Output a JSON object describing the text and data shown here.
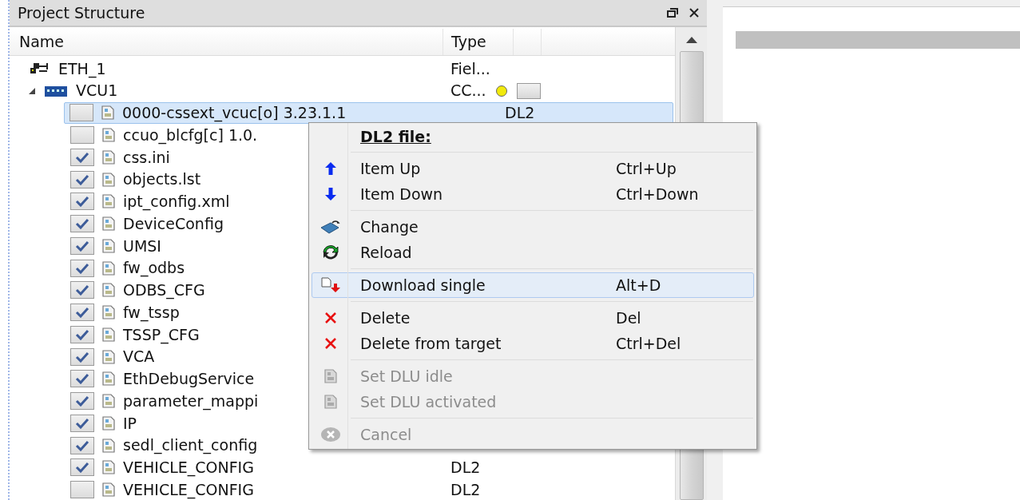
{
  "panel": {
    "title": "Project Structure"
  },
  "columns": [
    {
      "label": "Name"
    },
    {
      "label": "Type"
    }
  ],
  "tree": [
    {
      "kind": "network",
      "name": "ETH_1",
      "type": "Fiel...",
      "selected": false
    },
    {
      "kind": "device",
      "name": "VCU1",
      "type": "CC...",
      "color": "#f2ea0c",
      "expanded": true,
      "selected": false,
      "children": [
        {
          "kind": "file",
          "name": "0000-cssext_vcuc[o] 3.23.1.1",
          "type": "DL2",
          "checked": false,
          "selected": true
        },
        {
          "kind": "file",
          "name": "ccuo_blcfg[c] 1.0.",
          "checked": false,
          "selected": false
        },
        {
          "kind": "file",
          "name": "css.ini",
          "checked": true,
          "selected": false
        },
        {
          "kind": "file",
          "name": "objects.lst",
          "checked": true,
          "selected": false
        },
        {
          "kind": "file",
          "name": "ipt_config.xml",
          "checked": true,
          "selected": false
        },
        {
          "kind": "file",
          "name": "DeviceConfig",
          "checked": true,
          "selected": false
        },
        {
          "kind": "file",
          "name": "UMSI",
          "checked": true,
          "selected": false
        },
        {
          "kind": "file",
          "name": "fw_odbs",
          "checked": true,
          "selected": false
        },
        {
          "kind": "file",
          "name": "ODBS_CFG",
          "checked": true,
          "selected": false
        },
        {
          "kind": "file",
          "name": "fw_tssp",
          "checked": true,
          "selected": false
        },
        {
          "kind": "file",
          "name": "TSSP_CFG",
          "checked": true,
          "selected": false
        },
        {
          "kind": "file",
          "name": "VCA",
          "checked": true,
          "selected": false
        },
        {
          "kind": "file",
          "name": "EthDebugService",
          "checked": true,
          "selected": false
        },
        {
          "kind": "file",
          "name": "parameter_mappi",
          "checked": true,
          "selected": false
        },
        {
          "kind": "file",
          "name": "IP",
          "checked": true,
          "selected": false
        },
        {
          "kind": "file",
          "name": "sedl_client_config",
          "checked": true,
          "selected": false
        },
        {
          "kind": "file",
          "name": "VEHICLE_CONFIG",
          "type": "DL2",
          "checked": true,
          "selected": false
        },
        {
          "kind": "file",
          "name": "VEHICLE_CONFIG",
          "type": "DL2",
          "checked": false,
          "selected": false
        }
      ]
    }
  ],
  "context_menu": {
    "title": "DL2 file:",
    "groups": [
      [
        {
          "label": "Item Up",
          "shortcut": "Ctrl+Up",
          "disabled": false,
          "selected": false
        },
        {
          "label": "Item Down",
          "shortcut": "Ctrl+Down",
          "disabled": false,
          "selected": false
        }
      ],
      [
        {
          "label": "Change",
          "disabled": false,
          "selected": false
        },
        {
          "label": "Reload",
          "disabled": false,
          "selected": false
        }
      ],
      [
        {
          "label": "Download single",
          "shortcut": "Alt+D",
          "disabled": false,
          "selected": true
        }
      ],
      [
        {
          "label": "Delete",
          "shortcut": "Del",
          "disabled": false,
          "selected": false
        },
        {
          "label": "Delete from target",
          "shortcut": "Ctrl+Del",
          "disabled": false,
          "selected": false
        }
      ],
      [
        {
          "label": "Set DLU idle",
          "disabled": true,
          "selected": false
        },
        {
          "label": "Set DLU activated",
          "disabled": true,
          "selected": false
        }
      ],
      [
        {
          "label": "Cancel",
          "disabled": true,
          "selected": false
        }
      ]
    ]
  }
}
